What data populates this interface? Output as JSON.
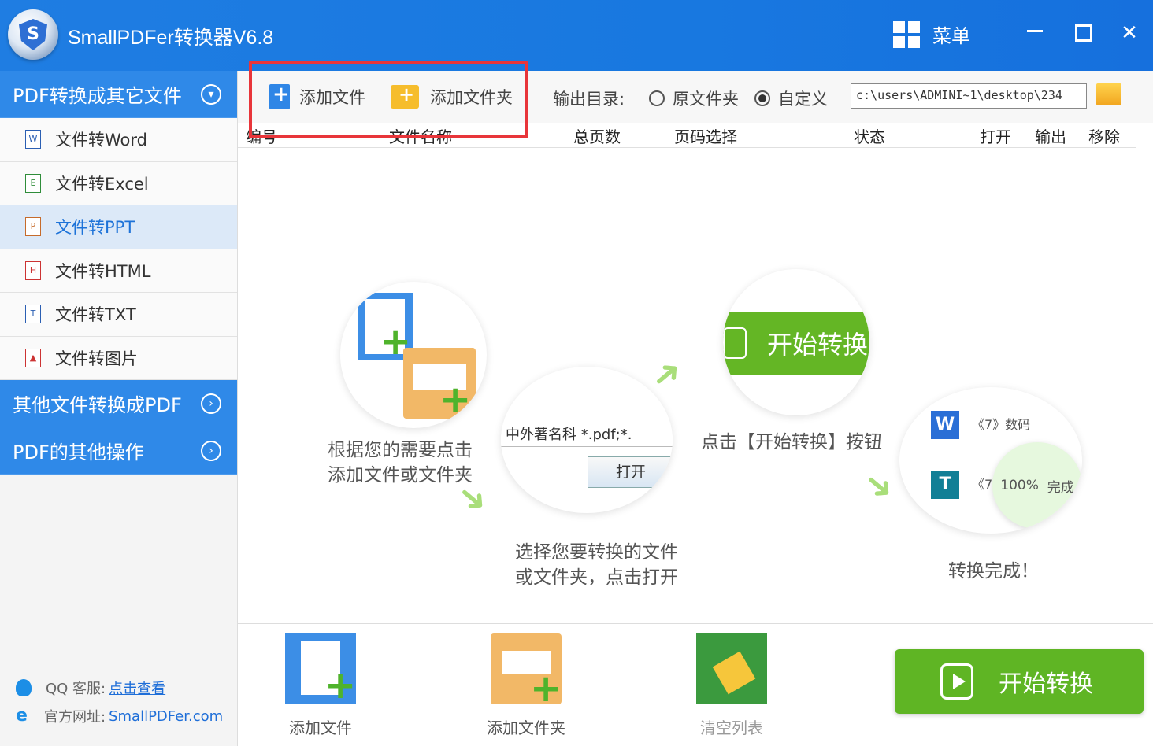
{
  "app": {
    "title": "SmallPDFer转换器V6.8",
    "menu_label": "菜单"
  },
  "sidebar": {
    "sections": [
      {
        "label": "PDF转换成其它文件"
      },
      {
        "label": "其他文件转换成PDF"
      },
      {
        "label": "PDF的其他操作"
      }
    ],
    "items": [
      {
        "label": "文件转Word",
        "icon": "word-icon",
        "glyph": "W"
      },
      {
        "label": "文件转Excel",
        "icon": "excel-icon",
        "glyph": "E"
      },
      {
        "label": "文件转PPT",
        "icon": "ppt-icon",
        "glyph": "P",
        "active": true
      },
      {
        "label": "文件转HTML",
        "icon": "html-icon",
        "glyph": "H"
      },
      {
        "label": "文件转TXT",
        "icon": "txt-icon",
        "glyph": "T"
      },
      {
        "label": "文件转图片",
        "icon": "image-icon",
        "glyph": "▲"
      }
    ],
    "footer": {
      "qq_label": "QQ 客服:",
      "qq_link": "点击查看",
      "site_label": "官方网址:",
      "site_link": "SmallPDFer.com"
    }
  },
  "toolbar": {
    "add_file": "添加文件",
    "add_folder": "添加文件夹",
    "output_label": "输出目录:",
    "radio_original": "原文件夹",
    "radio_custom": "自定义",
    "selected_radio": "自定义",
    "output_path": "c:\\users\\ADMINI~1\\desktop\\234"
  },
  "table": {
    "columns": [
      "编号",
      "文件名称",
      "总页数",
      "页码选择",
      "状态",
      "打开",
      "输出",
      "移除"
    ]
  },
  "guide": {
    "step1": [
      "根据您的需要点击",
      "添加文件或文件夹"
    ],
    "step2": [
      "选择您要转换的文件",
      "或文件夹，点击打开"
    ],
    "step3": "点击【开始转换】按钮",
    "step4": "转换完成！",
    "mini_start": "开始转换",
    "mini_pdf_name": "中外著名科",
    "mini_pdf_ext": "*.pdf;*.",
    "mini_open": "打开",
    "mini_row1": "《7》数码",
    "mini_row2": "《7》",
    "mini_progress": "100%",
    "mini_done": "完成"
  },
  "bottom": {
    "add_file": "添加文件",
    "add_folder": "添加文件夹",
    "clear_list": "清空列表",
    "start": "开始转换"
  },
  "colors": {
    "titlebar": "#1f7de2",
    "sidebar_section": "#2f89e8",
    "start_green": "#5fb524",
    "highlight_red": "#e8353a"
  }
}
